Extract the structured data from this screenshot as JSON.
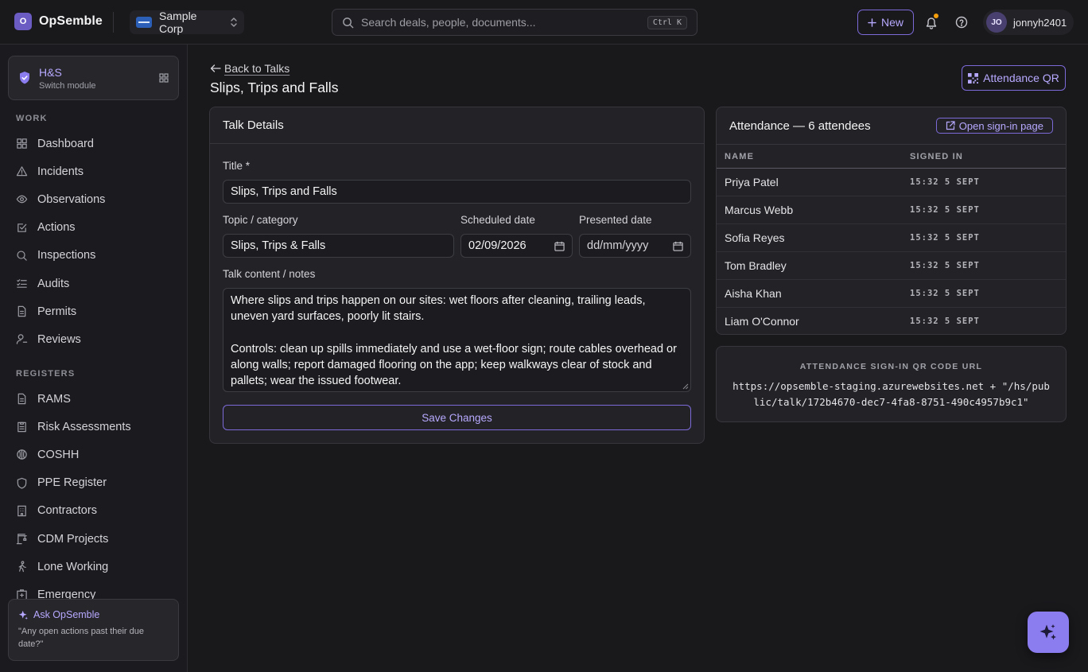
{
  "app": {
    "logo_letter": "O",
    "name": "OpSemble"
  },
  "org": {
    "name": "Sample Corp"
  },
  "search": {
    "placeholder": "Search deals, people, documents...",
    "shortcut": "Ctrl K"
  },
  "header": {
    "new_label": "New",
    "user_initials": "JO",
    "user_name": "jonnyh2401"
  },
  "module": {
    "title": "H&S",
    "subtitle": "Switch module"
  },
  "sidebar": {
    "work_label": "WORK",
    "work_items": [
      {
        "label": "Dashboard"
      },
      {
        "label": "Incidents"
      },
      {
        "label": "Observations"
      },
      {
        "label": "Actions"
      },
      {
        "label": "Inspections"
      },
      {
        "label": "Audits"
      },
      {
        "label": "Permits"
      },
      {
        "label": "Reviews"
      }
    ],
    "registers_label": "REGISTERS",
    "register_items": [
      {
        "label": "RAMS"
      },
      {
        "label": "Risk Assessments"
      },
      {
        "label": "COSHH"
      },
      {
        "label": "PPE Register"
      },
      {
        "label": "Contractors"
      },
      {
        "label": "CDM Projects"
      },
      {
        "label": "Lone Working"
      },
      {
        "label": "Emergency"
      }
    ],
    "ask": {
      "title": "Ask OpSemble",
      "hint": "\"Any open actions past their due date?\""
    }
  },
  "page": {
    "back_label": "Back to Talks",
    "title": "Slips, Trips and Falls",
    "qr_button": "Attendance QR"
  },
  "talk": {
    "header": "Talk Details",
    "title_label": "Title *",
    "title_value": "Slips, Trips and Falls",
    "topic_label": "Topic / category",
    "topic_value": "Slips, Trips & Falls",
    "scheduled_label": "Scheduled date",
    "scheduled_value": "02/09/2026",
    "presented_label": "Presented date",
    "presented_placeholder": "dd/mm/yyyy",
    "content_label": "Talk content / notes",
    "content_p1": "Where slips and trips happen on our sites: wet floors after cleaning, trailing leads, uneven yard surfaces, poorly lit stairs.",
    "content_p2": "Controls: clean up spills immediately and use a wet-floor sign; route cables overhead or along walls; report damaged flooring on the app; keep walkways clear of stock and pallets; wear the issued footwear.",
    "save_label": "Save Changes"
  },
  "attendance": {
    "title": "Attendance — 6 attendees",
    "open_signin": "Open sign-in page",
    "col_name": "NAME",
    "col_signed": "SIGNED IN",
    "rows": [
      {
        "name": "Priya Patel",
        "signed": "15:32 5 SEPT"
      },
      {
        "name": "Marcus Webb",
        "signed": "15:32 5 SEPT"
      },
      {
        "name": "Sofia Reyes",
        "signed": "15:32 5 SEPT"
      },
      {
        "name": "Tom Bradley",
        "signed": "15:32 5 SEPT"
      },
      {
        "name": "Aisha Khan",
        "signed": "15:32 5 SEPT"
      },
      {
        "name": "Liam O'Connor",
        "signed": "15:32 5 SEPT"
      }
    ]
  },
  "qr": {
    "label": "ATTENDANCE SIGN-IN QR CODE URL",
    "url": "https://opsemble-staging.azurewebsites.net + \"/hs/public/talk/172b4670-dec7-4fa8-8751-490c4957b9c1\""
  },
  "colors": {
    "accent": "#8b7cf0",
    "background": "#19191c",
    "card": "#232327",
    "notification": "#f59e0b"
  }
}
